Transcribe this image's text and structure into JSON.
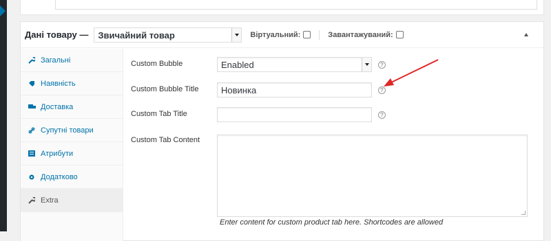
{
  "colors": {
    "accent": "#0073aa",
    "arrow": "#e02727",
    "admin_bar": "#23282d"
  },
  "product_data": {
    "title": "Дані товару —",
    "product_type": "Звичайний товар",
    "virtual_label": "Віртуальний:",
    "downloadable_label": "Завантажуваний:",
    "virtual_checked": false,
    "downloadable_checked": false
  },
  "tabs": [
    {
      "label": "Загальні",
      "icon": "wrench-icon",
      "active": false
    },
    {
      "label": "Наявність",
      "icon": "tag-icon",
      "active": false
    },
    {
      "label": "Доставка",
      "icon": "truck-icon",
      "active": false
    },
    {
      "label": "Супутні товари",
      "icon": "link-icon",
      "active": false
    },
    {
      "label": "Атрибути",
      "icon": "list-icon",
      "active": false
    },
    {
      "label": "Додатково",
      "icon": "gear-icon",
      "active": false
    },
    {
      "label": "Extra",
      "icon": "wrench-icon",
      "active": true
    }
  ],
  "fields": {
    "custom_bubble": {
      "label": "Custom Bubble",
      "value": "Enabled"
    },
    "custom_bubble_title": {
      "label": "Custom Bubble Title",
      "value": "Новинка"
    },
    "custom_tab_title": {
      "label": "Custom Tab Title",
      "value": ""
    },
    "custom_tab_content": {
      "label": "Custom Tab Content",
      "value": "",
      "description": "Enter content for custom product tab here. Shortcodes are allowed"
    }
  },
  "help_symbol": "?"
}
